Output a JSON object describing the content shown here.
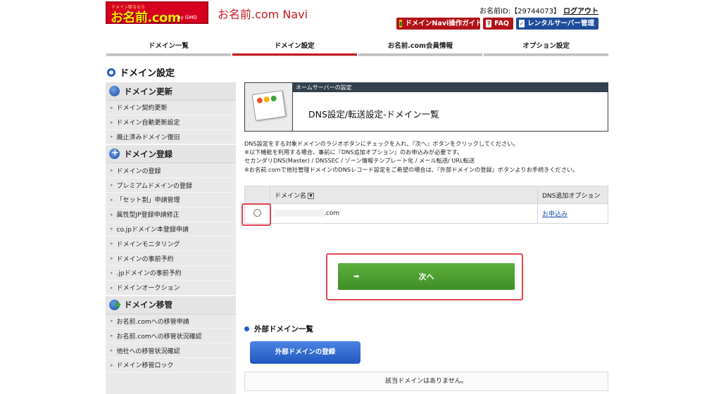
{
  "header": {
    "logo_tagline": "ドメイン取るなら",
    "logo_text": "お名前.com",
    "logo_sub": "by GMO",
    "app_title": "お名前.com Navi",
    "user_id_label": "お名前ID:【29744073】",
    "logout": "ログアウト",
    "buttons": {
      "guide": "ドメインNavi操作ガイド",
      "faq": "FAQ",
      "rental": "レンタルサーバー管理"
    }
  },
  "tabs": [
    {
      "label": "ドメイン一覧"
    },
    {
      "label": "ドメイン設定"
    },
    {
      "label": "お名前.com会員情報"
    },
    {
      "label": "オプション設定"
    }
  ],
  "section_title": "ドメイン設定",
  "sidebar": {
    "groups": [
      {
        "title": "ドメイン更新",
        "items": [
          "ドメイン契約更新",
          "ドメイン自動更新設定",
          "廃止済みドメイン復旧"
        ]
      },
      {
        "title": "ドメイン登録",
        "items": [
          "ドメインの登録",
          "プレミアムドメインの登録",
          "「セット割」申請管理",
          "属性型JP登録申請修正",
          "co.jpドメイン本登録申請",
          "ドメインモニタリング",
          "ドメインの事前予約",
          ".jpドメインの事前予約",
          "ドメインオークション"
        ]
      },
      {
        "title": "ドメイン移管",
        "items": [
          "お名前.comへの移管申請",
          "お名前.comへの移管状況確認",
          "他社への移管状況確認",
          "ドメイン移管ロック"
        ]
      }
    ]
  },
  "panel": {
    "bar_label": "ネームサーバーの設定",
    "heading": "DNS設定/転送設定-ドメイン一覧"
  },
  "notes": [
    "DNS設定をする対象ドメインのラジオボタンにチェックを入れ、『次へ』ボタンをクリックしてください。",
    "※以下機能を利用する場合、事前に『DNS追加オプション』のお申込みが必要です。",
    "セカンダリDNS(Master) / DNSSEC / ゾーン情報テンプレート化 / メール転送/ URL転送",
    "※お名前.comで他社管理ドメインのDNSレコード設定をご希望の場合は、『外部ドメインの登録』ボタンよりお手続きください。"
  ],
  "table": {
    "headers": {
      "domain": "ドメイン名",
      "dns_option": "DNS追加オプション"
    },
    "rows": [
      {
        "domain_suffix": ".com",
        "option_link": "お申込み"
      }
    ]
  },
  "next_button": "次へ",
  "external": {
    "title": "外部ドメイン一覧",
    "register_button": "外部ドメインの登録",
    "empty_message": "該当ドメインはありません。"
  }
}
